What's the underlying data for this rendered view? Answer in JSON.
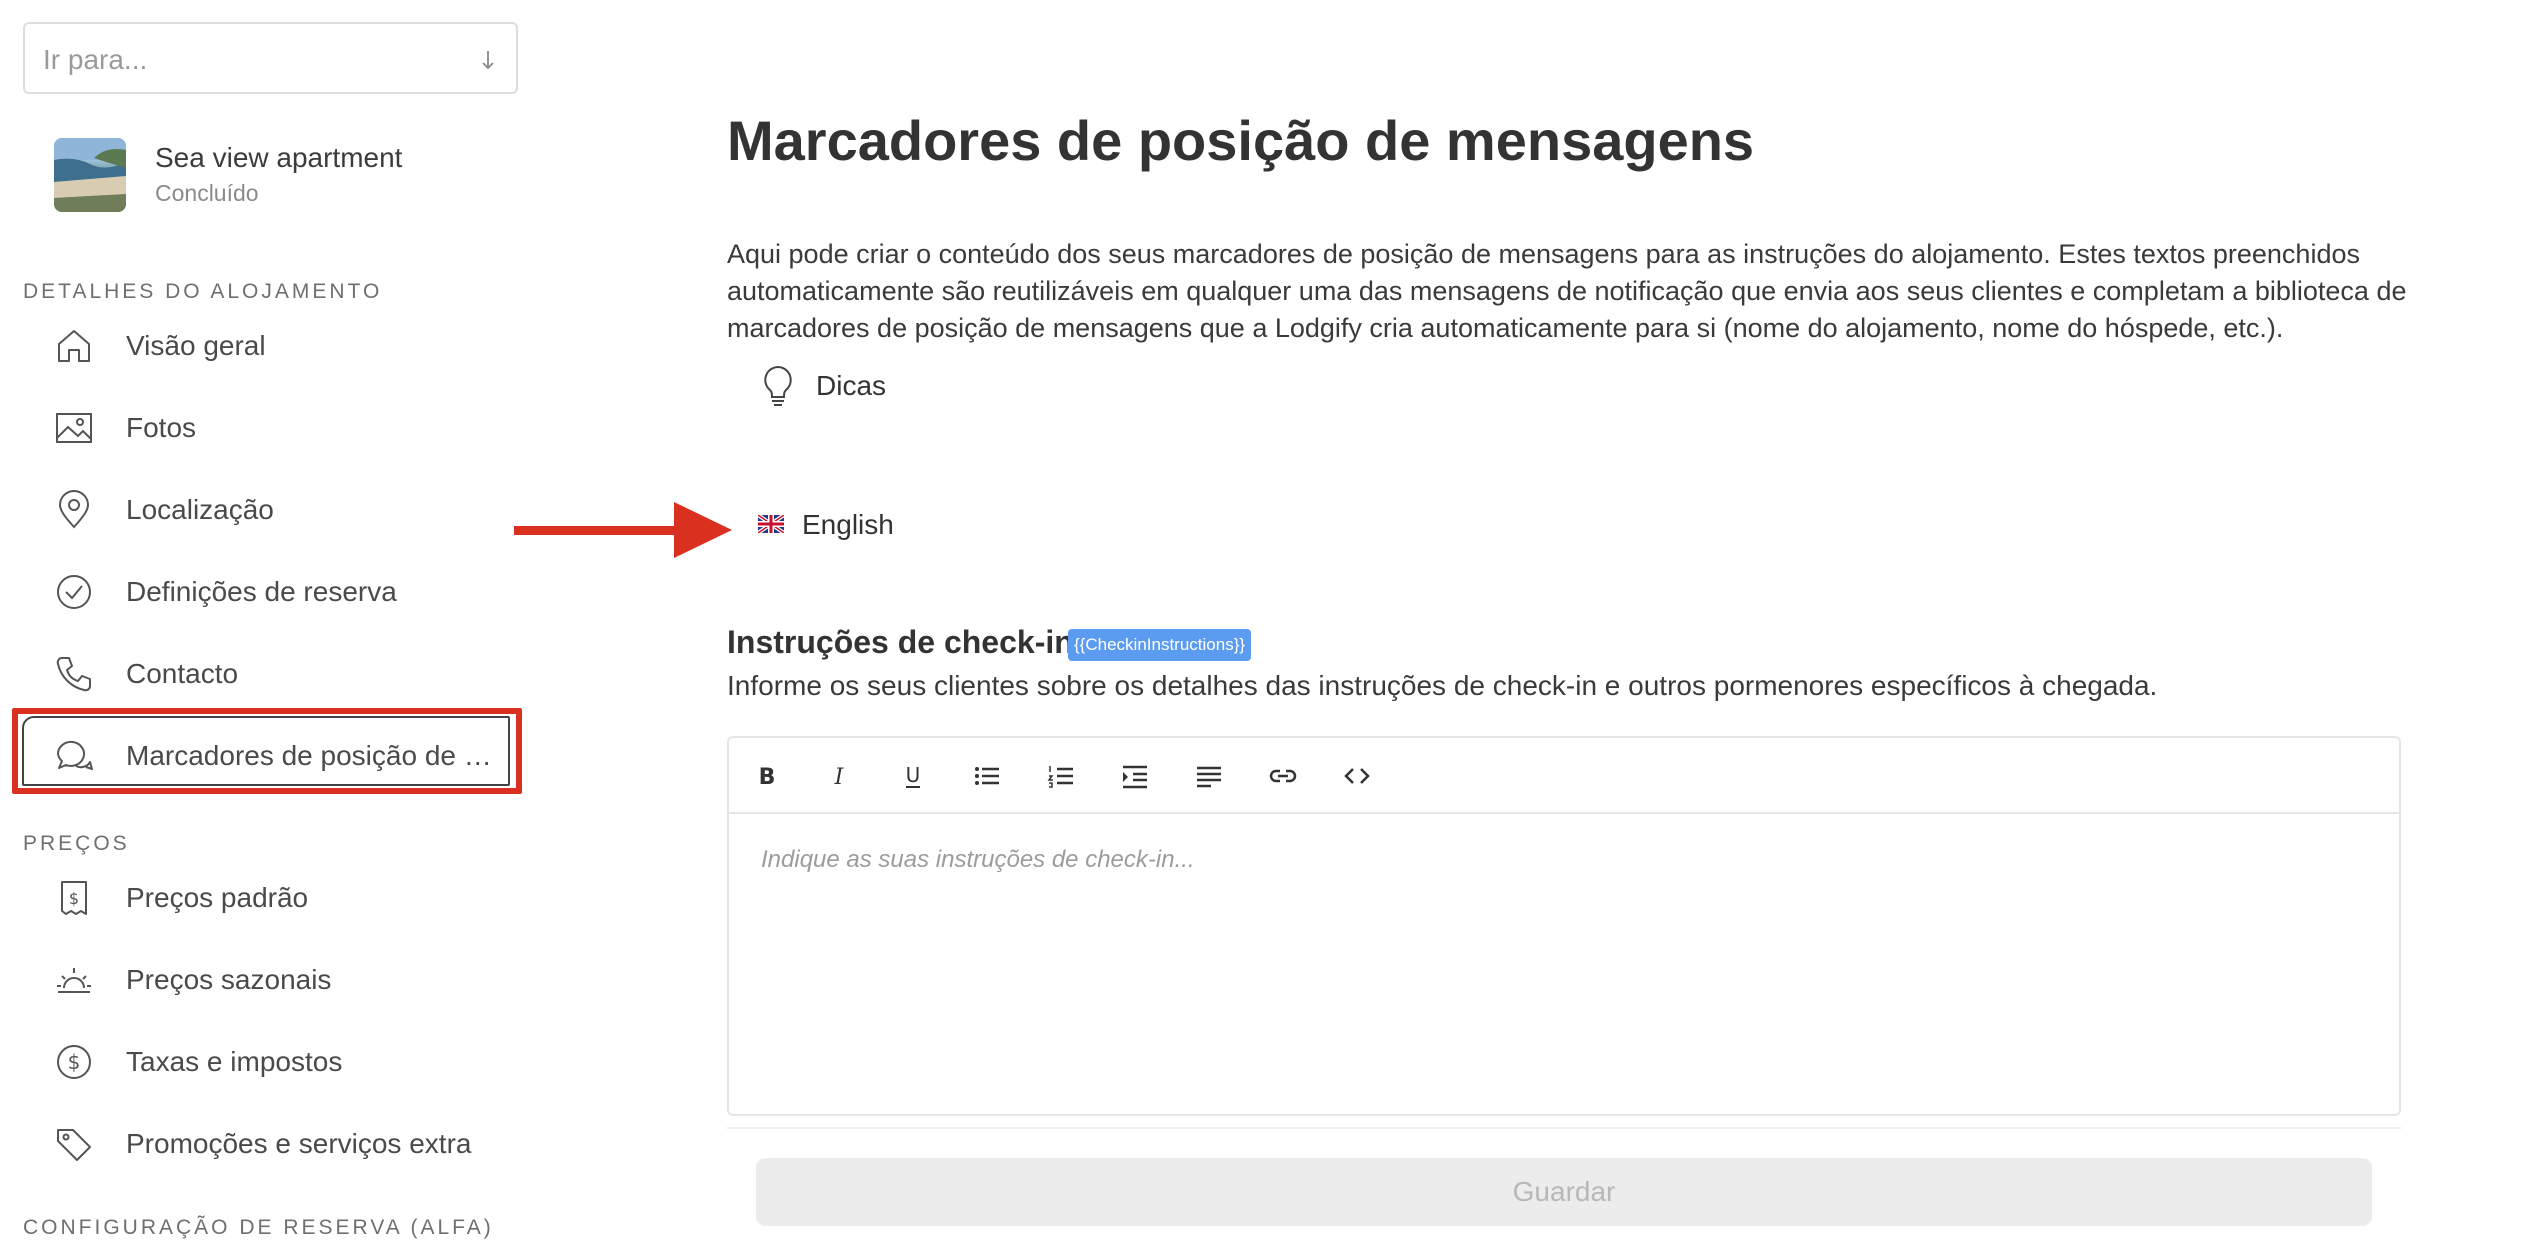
{
  "sidebar": {
    "goto_placeholder": "Ir para...",
    "property": {
      "name": "Sea view apartment",
      "status": "Concluído"
    },
    "sections": [
      {
        "label": "DETALHES DO ALOJAMENTO",
        "items": [
          {
            "label": "Visão geral",
            "icon": "home-icon"
          },
          {
            "label": "Fotos",
            "icon": "image-icon"
          },
          {
            "label": "Localização",
            "icon": "location-pin-icon"
          },
          {
            "label": "Definições de reserva",
            "icon": "check-circle-icon"
          },
          {
            "label": "Contacto",
            "icon": "phone-icon"
          },
          {
            "label": "Marcadores de posição de …",
            "icon": "chat-bubbles-icon",
            "active": true
          }
        ]
      },
      {
        "label": "PREÇOS",
        "items": [
          {
            "label": "Preços padrão",
            "icon": "price-tag-doc-icon"
          },
          {
            "label": "Preços sazonais",
            "icon": "sun-icon"
          },
          {
            "label": "Taxas e impostos",
            "icon": "dollar-circle-icon"
          },
          {
            "label": "Promoções e serviços extra",
            "icon": "tag-icon"
          }
        ]
      },
      {
        "label": "CONFIGURAÇÃO DE RESERVA (ALFA)",
        "items": []
      }
    ]
  },
  "main": {
    "title": "Marcadores de posição de mensagens",
    "description": "Aqui pode criar o conteúdo dos seus marcadores de posição de mensagens para as instruções do alojamento. Estes textos preenchidos automaticamente são reutilizáveis em qualquer uma das mensagens de notificação que envia aos seus clientes e completam a biblioteca de marcadores de posição de mensagens que a Lodgify cria automaticamente para si (nome do alojamento, nome do hóspede, etc.).",
    "tips_label": "Dicas",
    "language": "English",
    "field": {
      "title": "Instruções de check-in",
      "token": "{{CheckinInstructions}}",
      "description": "Informe os seus clientes sobre os detalhes das instruções de check-in e outros pormenores específicos à chegada.",
      "placeholder": "Indique as suas instruções de check-in..."
    },
    "toolbar": [
      {
        "name": "bold-button",
        "label": "B"
      },
      {
        "name": "italic-button",
        "label": "I"
      },
      {
        "name": "underline-button",
        "label": "U"
      },
      {
        "name": "bulleted-list-button",
        "label": ""
      },
      {
        "name": "numbered-list-button",
        "label": ""
      },
      {
        "name": "indent-button",
        "label": ""
      },
      {
        "name": "align-button",
        "label": ""
      },
      {
        "name": "link-button",
        "label": ""
      },
      {
        "name": "code-button",
        "label": "<>"
      }
    ],
    "save_label": "Guardar"
  },
  "colors": {
    "highlight": "#d9301f",
    "token_bg": "#5b9cf0",
    "save_bg": "#ececec"
  }
}
